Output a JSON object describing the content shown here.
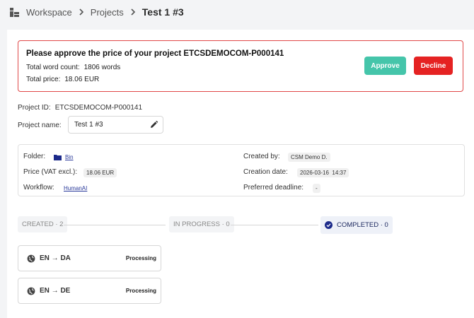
{
  "breadcrumb": {
    "items": [
      "Workspace",
      "Projects"
    ],
    "current": "Test 1 #3"
  },
  "alert": {
    "title": "Please approve the price of your project ETCSDEMOCOM-P000141",
    "word_count_label": "Total word count:",
    "word_count_value": "1806 words",
    "price_label": "Total price:",
    "price_value": "18.06 EUR",
    "approve_label": "Approve",
    "decline_label": "Decline"
  },
  "project": {
    "id_label": "Project ID:",
    "id_value": "ETCSDEMOCOM-P000141",
    "name_label": "Project name:",
    "name_value": "Test 1 #3"
  },
  "details": {
    "folder_label": "Folder:",
    "folder_value": "Bin",
    "price_label": "Price (VAT excl.):",
    "price_value": "18.06 EUR",
    "workflow_label": "Workflow:",
    "workflow_value": "HumanAI",
    "created_by_label": "Created by:",
    "created_by_value": "CSM Demo D.",
    "creation_date_label": "Creation date:",
    "creation_date_value": "2026-03-16  14:37",
    "deadline_label": "Preferred deadline:",
    "deadline_value": "-"
  },
  "stages": {
    "created": "CREATED · 2",
    "in_progress": "IN PROGRESS · 0",
    "completed": "COMPLETED · 0"
  },
  "tasks": [
    {
      "lang": "EN → DA",
      "status": "Processing"
    },
    {
      "lang": "EN → DE",
      "status": "Processing"
    }
  ],
  "colors": {
    "approve": "#45c5aa",
    "decline": "#e52222",
    "alert_border": "#e04848",
    "link": "#2a3a9a"
  }
}
